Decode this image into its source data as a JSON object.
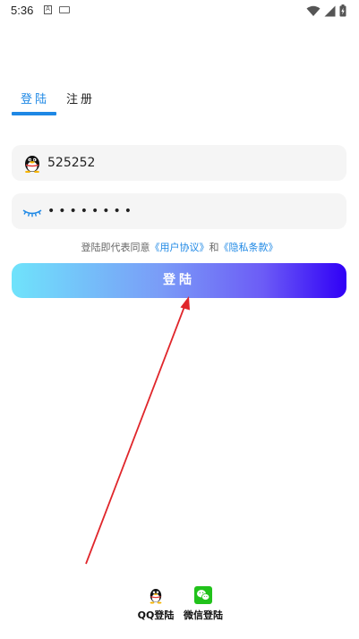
{
  "status_bar": {
    "time": "5:36",
    "badge": "A",
    "icons": [
      "keyboard-icon",
      "wifi-icon",
      "signal-icon",
      "battery-charging-icon"
    ]
  },
  "tabs": [
    {
      "label": "登陆",
      "active": true
    },
    {
      "label": "注册",
      "active": false
    }
  ],
  "account_field": {
    "icon": "qq-penguin-icon",
    "value": "525252"
  },
  "password_field": {
    "icon": "eye-closed-icon",
    "value": "••••••••"
  },
  "agreement": {
    "prefix": "登陆即代表同意",
    "user_agreement": "《用户协议》",
    "and": "和",
    "privacy_policy": "《隐私条款》"
  },
  "login_button": {
    "label": "登陆"
  },
  "third_party": [
    {
      "icon": "qq-icon",
      "label": "QQ登陆"
    },
    {
      "icon": "wechat-icon",
      "label": "微信登陆"
    }
  ],
  "colors": {
    "accent": "#1e88e5",
    "field_bg": "#f5f5f5",
    "button_gradient_start": "#6fe3fb",
    "button_gradient_end": "#3000f6",
    "annotation_arrow": "#e0262b",
    "wechat_green": "#21c21b"
  }
}
